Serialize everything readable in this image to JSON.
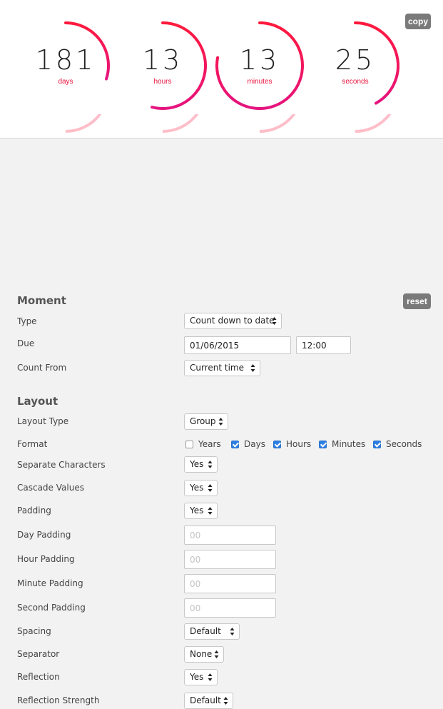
{
  "preview": {
    "copy_label": "copy",
    "units": [
      {
        "value": "181",
        "label": "days",
        "fraction": 0.3
      },
      {
        "value": "13",
        "label": "hours",
        "fraction": 0.54
      },
      {
        "value": "13",
        "label": "minutes",
        "fraction": 0.78
      },
      {
        "value": "25",
        "label": "seconds",
        "fraction": 0.42
      }
    ],
    "colors": {
      "ring_start": "#ff1a3c",
      "ring_end": "#e5147f",
      "label": "#e8143d"
    }
  },
  "moment": {
    "title": "Moment",
    "reset_label": "reset",
    "type": {
      "label": "Type",
      "value": "Count down to date"
    },
    "due": {
      "label": "Due",
      "date": "01/06/2015",
      "time": "12:00"
    },
    "count_from": {
      "label": "Count From",
      "value": "Current time"
    }
  },
  "layout": {
    "title": "Layout",
    "layout_type": {
      "label": "Layout Type",
      "value": "Group"
    },
    "format": {
      "label": "Format",
      "options": [
        {
          "label": "Years",
          "checked": false
        },
        {
          "label": "Days",
          "checked": true
        },
        {
          "label": "Hours",
          "checked": true
        },
        {
          "label": "Minutes",
          "checked": true
        },
        {
          "label": "Seconds",
          "checked": true
        }
      ]
    },
    "separate_characters": {
      "label": "Separate Characters",
      "value": "Yes"
    },
    "cascade_values": {
      "label": "Cascade Values",
      "value": "Yes"
    },
    "padding": {
      "label": "Padding",
      "value": "Yes"
    },
    "day_padding": {
      "label": "Day Padding",
      "placeholder": "00"
    },
    "hour_padding": {
      "label": "Hour Padding",
      "placeholder": "00"
    },
    "minute_padding": {
      "label": "Minute Padding",
      "placeholder": "00"
    },
    "second_padding": {
      "label": "Second Padding",
      "placeholder": "00"
    },
    "spacing": {
      "label": "Spacing",
      "value": "Default"
    },
    "separator": {
      "label": "Separator",
      "value": "None"
    },
    "reflection": {
      "label": "Reflection",
      "value": "Yes"
    },
    "reflection_strength": {
      "label": "Reflection Strength",
      "value": "Default"
    }
  }
}
